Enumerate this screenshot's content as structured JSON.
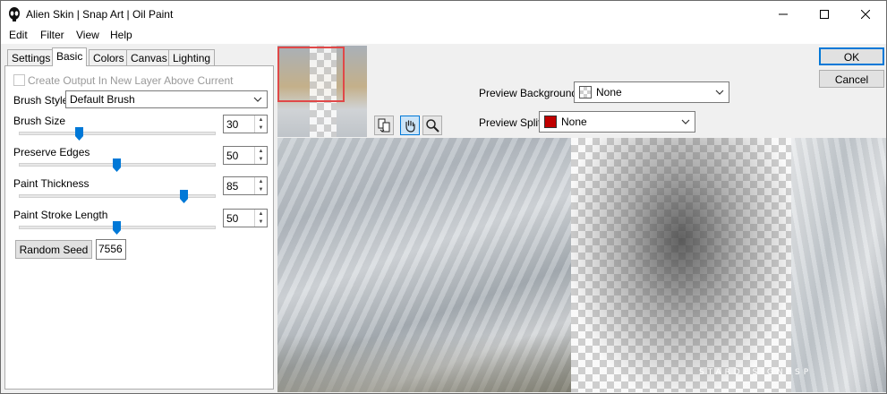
{
  "window": {
    "title": "Alien Skin | Snap Art | Oil Paint"
  },
  "menu": [
    "Edit",
    "Filter",
    "View",
    "Help"
  ],
  "tabs": [
    "Settings",
    "Basic",
    "Colors",
    "Canvas",
    "Lighting"
  ],
  "active_tab": "Basic",
  "basic": {
    "create_output_label": "Create Output In New Layer Above Current",
    "create_output_checked": false,
    "brush_style_label": "Brush Style:",
    "brush_style_value": "Default Brush",
    "brush_size_label": "Brush Size",
    "brush_size_value": "30",
    "preserve_edges_label": "Preserve Edges",
    "preserve_edges_value": "50",
    "paint_thickness_label": "Paint Thickness",
    "paint_thickness_value": "85",
    "stroke_length_label": "Paint Stroke Length",
    "stroke_length_value": "50",
    "random_seed_label": "Random Seed",
    "random_seed_value": "7556"
  },
  "preview_controls": {
    "background_label": "Preview Background:",
    "background_value": "None",
    "split_label": "Preview Split:",
    "split_value": "None",
    "split_swatch_color": "#c00000"
  },
  "buttons": {
    "ok": "OK",
    "cancel": "Cancel"
  },
  "watermark": "STARDESIGNPSP",
  "colors": {
    "accent": "#0078d7",
    "selection_rect": "#e04848"
  }
}
